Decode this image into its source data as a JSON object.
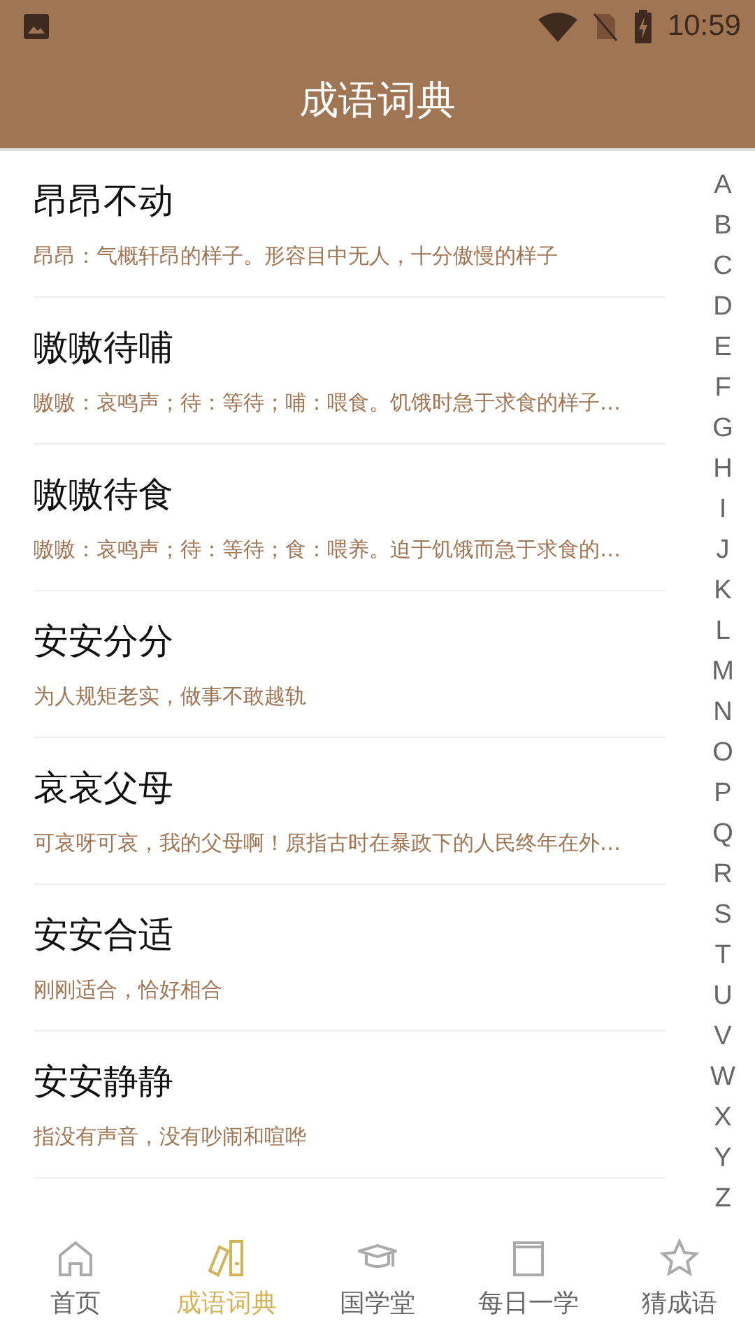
{
  "status_bar": {
    "time": "10:59"
  },
  "app_bar": {
    "title": "成语词典"
  },
  "entries": [
    {
      "idiom": "昂昂不动",
      "meaning": "昂昂：气概轩昂的样子。形容目中无人，十分傲慢的样子"
    },
    {
      "idiom": "嗷嗷待哺",
      "meaning": "嗷嗷：哀鸣声；待：等待；哺：喂食。饥饿时急于求食的样子…"
    },
    {
      "idiom": "嗷嗷待食",
      "meaning": "嗷嗷：哀鸣声；待：等待；食：喂养。迫于饥饿而急于求食的…"
    },
    {
      "idiom": "安安分分",
      "meaning": "为人规矩老实，做事不敢越轨"
    },
    {
      "idiom": "哀哀父母",
      "meaning": "可哀呀可哀，我的父母啊！原指古时在暴政下的人民终年在外…"
    },
    {
      "idiom": "安安合适",
      "meaning": "刚刚适合，恰好相合"
    },
    {
      "idiom": "安安静静",
      "meaning": "指没有声音，没有吵闹和喧哗"
    }
  ],
  "index_letters": [
    "A",
    "B",
    "C",
    "D",
    "E",
    "F",
    "G",
    "H",
    "I",
    "J",
    "K",
    "L",
    "M",
    "N",
    "O",
    "P",
    "Q",
    "R",
    "S",
    "T",
    "U",
    "V",
    "W",
    "X",
    "Y",
    "Z"
  ],
  "bottom_nav": [
    {
      "kind": "home",
      "label": "首页",
      "selected": false
    },
    {
      "kind": "books",
      "label": "成语词典",
      "selected": true
    },
    {
      "kind": "cap",
      "label": "国学堂",
      "selected": false
    },
    {
      "kind": "page",
      "label": "每日一学",
      "selected": false
    },
    {
      "kind": "star",
      "label": "猜成语",
      "selected": false
    }
  ]
}
